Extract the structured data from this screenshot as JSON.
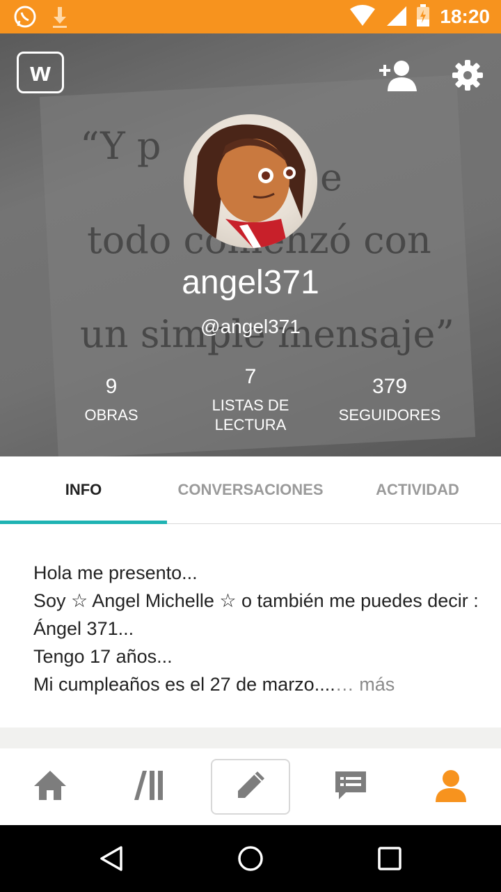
{
  "status_bar": {
    "time": "18:20",
    "left_icons": [
      "whatsapp-icon",
      "download-icon"
    ],
    "right_icons": [
      "wifi-icon",
      "signal-icon",
      "battery-icon"
    ],
    "bg_color": "#f7931e"
  },
  "header": {
    "logo_letter": "w",
    "username": "angel371",
    "handle": "@angel371",
    "background_text": [
      "“Y p",
      "e",
      "todo comenzó con",
      "un simple mensaje”"
    ],
    "stats": [
      {
        "number": "9",
        "label": "OBRAS"
      },
      {
        "number": "7",
        "label": "LISTAS DE LECTURA"
      },
      {
        "number": "379",
        "label": "SEGUIDORES"
      }
    ]
  },
  "tabs": [
    {
      "label": "INFO",
      "active": true
    },
    {
      "label": "CONVERSACIONES",
      "active": false
    },
    {
      "label": "ACTIVIDAD",
      "active": false
    }
  ],
  "info": {
    "lines": [
      "Hola me presento...",
      "Soy ☆ Angel Michelle ☆ o también me puedes decir : Ángel 371...",
      "Tengo 17 años...",
      "Mi cumpleaños es el 27 de marzo...."
    ],
    "more_label": "… más"
  },
  "bottom_nav": [
    "home-icon",
    "library-icon",
    "write-icon",
    "messages-icon",
    "profile-icon"
  ],
  "colors": {
    "accent": "#f7931e",
    "tab_indicator": "#1fb3b3"
  }
}
